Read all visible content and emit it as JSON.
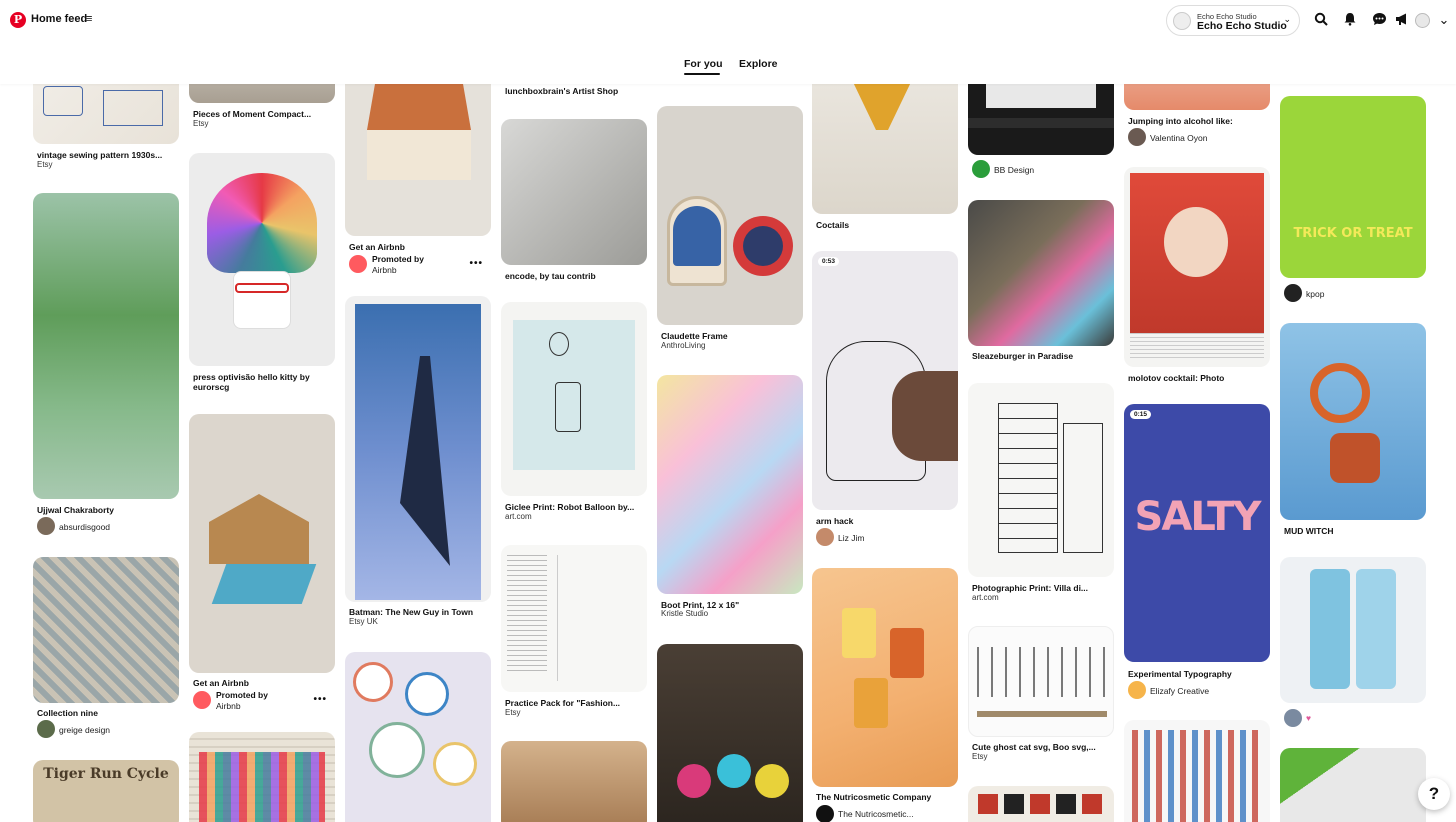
{
  "header": {
    "home_feed": "Home feed",
    "logo": "P",
    "tabs": [
      "For you",
      "Explore"
    ],
    "account_small": "Echo Echo Studio",
    "account_name": "Echo Echo Studio"
  },
  "pins": {
    "c1": [
      {
        "title": "vintage sewing pattern 1930s...",
        "sub": "Etsy"
      },
      {
        "title": "Ujjwal Chakraborty",
        "user": "absurdisgood"
      },
      {
        "title": "Collection nine",
        "user": "greige design"
      },
      {
        "text": "Tiger Run Cycle"
      }
    ],
    "c2": [
      {
        "title": "Pieces of Moment Compact...",
        "sub": "Etsy"
      },
      {
        "title": "press optivisão hello kitty by",
        "title2": "eurorscg"
      },
      {
        "title": "Get an Airbnb",
        "promo": "Promoted by",
        "promo_by": "Airbnb",
        "more": "•••"
      }
    ],
    "c3": [
      {
        "title": "Get an Airbnb",
        "promo": "Promoted by",
        "promo_by": "Airbnb",
        "more": "•••"
      },
      {
        "title": "Batman: The New Guy in Town",
        "sub": "Etsy UK"
      }
    ],
    "c4": [
      {
        "title": "lunchboxbrain's Artist Shop"
      },
      {
        "title": "encode, by tau contrib"
      },
      {
        "title": "Giclee Print: Robot Balloon by...",
        "sub": "art.com"
      },
      {
        "title": "Practice Pack for \"Fashion...",
        "sub": "Etsy"
      }
    ],
    "c5": [
      {
        "title": "Claudette Frame",
        "sub": "AnthroLiving"
      },
      {
        "title": "Boot Print, 12 x 16\"",
        "sub": "Kristle Studio"
      }
    ],
    "c6": [
      {
        "title": "Coctails"
      },
      {
        "title": "arm hack",
        "user": "Liz Jim",
        "duration": "0:53"
      },
      {
        "title": "The Nutricosmetic Company",
        "user": "The Nutricosmetic..."
      }
    ],
    "c7": [
      {
        "title": "BB Design"
      },
      {
        "title": "Sleazeburger in Paradise"
      },
      {
        "title": "Photographic Print: Villa di...",
        "sub": "art.com"
      },
      {
        "title": "Cute ghost cat svg, Boo svg,...",
        "sub": "Etsy"
      }
    ],
    "c8": [
      {
        "title": "Jumping into alcohol like:",
        "user": "Valentina Oyon"
      },
      {
        "title": "molotov cocktail: Photo"
      },
      {
        "title": "Experimental Typography",
        "user": "Elizafy Creative",
        "duration": "0:15",
        "art": "SALTY"
      }
    ],
    "c9": [
      {
        "title": "kpop",
        "art": "TRICK OR TREAT"
      },
      {
        "title": "MUD WITCH"
      },
      {
        "user": "♥"
      }
    ]
  },
  "help": "?",
  "colors": {
    "brand": "#e60023"
  }
}
